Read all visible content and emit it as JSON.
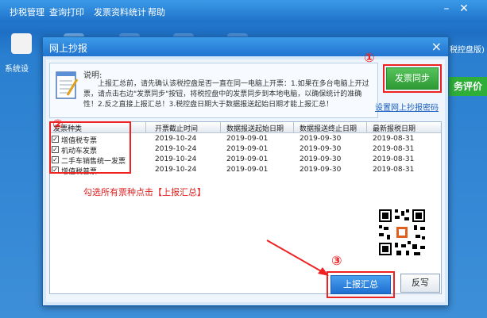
{
  "menu": {
    "items": [
      "抄税管理",
      "查询打印",
      "发票资料统计",
      "帮助"
    ]
  },
  "toolbar": {
    "first_label": "系统设",
    "right_tag": "税控盘版)",
    "side_green": "务评价"
  },
  "dialog": {
    "title": "网上抄报",
    "info_heading": "说明:",
    "info_text": "上报汇总前，请先确认该税控盘是否一直在同一电脑上开票：1.如果在多台电脑上开过票，请点击右边\"发票同步\"按钮，将税控盘中的发票同步到本地电脑，以确保统计的准确性！2.反之直接上报汇总！3.税控盘日期大于数据报送起始日期才能上报汇总！",
    "sync_button": "发票同步",
    "password_link": "设置网上抄报密码",
    "table": {
      "headers": [
        "发票种类",
        "开票截止时间",
        "数据报送起始日期",
        "数据报送终止日期",
        "最新报税日期"
      ],
      "rows": [
        {
          "checked": "✓",
          "type": "增值税专票",
          "cutoff": "2019-10-24",
          "start": "2019-09-01",
          "end": "2019-09-30",
          "latest": "2019-08-31"
        },
        {
          "checked": "✓",
          "type": "机动车发票",
          "cutoff": "2019-10-24",
          "start": "2019-09-01",
          "end": "2019-09-30",
          "latest": "2019-08-31"
        },
        {
          "checked": "✓",
          "type": "二手车销售统一发票",
          "cutoff": "2019-10-24",
          "start": "2019-09-01",
          "end": "2019-09-30",
          "latest": "2019-08-31"
        },
        {
          "checked": "✓",
          "type": "增值税普票",
          "cutoff": "2019-10-24",
          "start": "2019-09-01",
          "end": "2019-09-30",
          "latest": "2019-08-31"
        }
      ]
    },
    "instruction": "勾选所有票种点击【上报汇总】",
    "submit_button": "上报汇总",
    "reverse_button": "反写"
  },
  "markers": {
    "one": "①",
    "two": "②",
    "three": "③"
  },
  "colors": {
    "accent_red": "#e22222",
    "title_blue": "#2174cf",
    "sync_green": "#2d9a33"
  }
}
